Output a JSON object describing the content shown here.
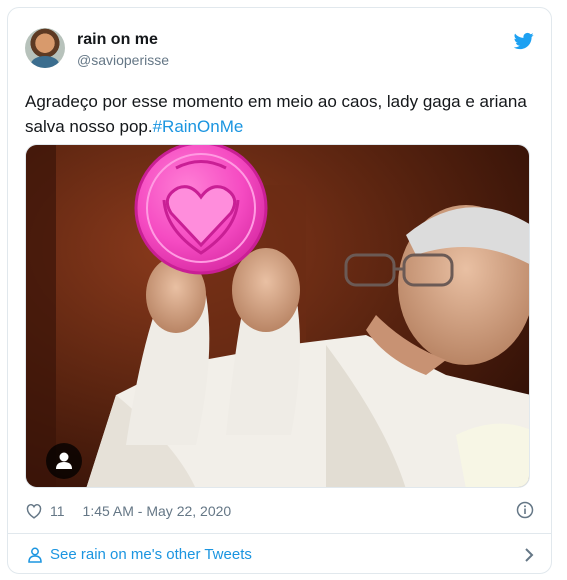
{
  "tweet": {
    "display_name": "rain on me",
    "handle": "@savioperisse",
    "text": "Agradeço por esse momento em meio ao caos, lady gaga e ariana salva nosso pop.",
    "hashtag": "#RainOnMe",
    "likes": "11",
    "timestamp": "1:45 AM - May 22, 2020"
  },
  "footer": {
    "link_text": "See rain on me's other Tweets"
  },
  "colors": {
    "link": "#1b95e0",
    "twitter_blue": "#1da1f2",
    "muted": "#657786",
    "border": "#e1e8ed"
  },
  "icons": [
    "twitter-bird-icon",
    "heart-icon",
    "info-icon",
    "user-icon",
    "chevron-right-icon",
    "media-user-icon"
  ]
}
